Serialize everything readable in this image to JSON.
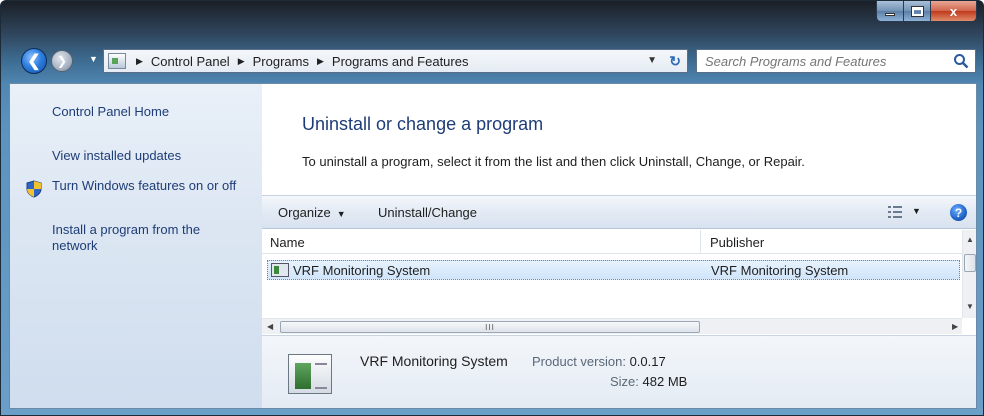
{
  "window": {
    "caption_buttons": {
      "minimize_icon": "minimize-icon",
      "maximize_icon": "maximize-icon",
      "close_glyph": "x"
    }
  },
  "navigation": {
    "back_icon": "back-arrow-icon",
    "forward_icon": "forward-arrow-icon",
    "breadcrumbs": [
      "Control Panel",
      "Programs",
      "Programs and Features"
    ],
    "search_placeholder": "Search Programs and Features"
  },
  "sidebar": {
    "links": [
      {
        "label": "Control Panel Home"
      },
      {
        "label": "View installed updates"
      },
      {
        "label": "Turn Windows features on or off",
        "icon": "shield-icon"
      },
      {
        "label": "Install a program from the network"
      }
    ]
  },
  "main": {
    "title": "Uninstall or change a program",
    "description": "To uninstall a program, select it from the list and then click Uninstall, Change, or Repair."
  },
  "toolbar": {
    "organize_label": "Organize",
    "uninstall_change_label": "Uninstall/Change",
    "help_glyph": "?"
  },
  "list": {
    "columns": [
      "Name",
      "Publisher"
    ],
    "rows": [
      {
        "name": "VRF Monitoring System",
        "publisher": "VRF Monitoring System",
        "selected": true
      }
    ],
    "hscroll_grip": "III"
  },
  "details": {
    "name": "VRF Monitoring System",
    "product_version_label": "Product version:",
    "product_version": "0.0.17",
    "size_label": "Size:",
    "size": "482 MB"
  },
  "colors": {
    "link": "#1e3d76",
    "selection": "#cfe5fb",
    "title_bar": "#4f86b2"
  }
}
